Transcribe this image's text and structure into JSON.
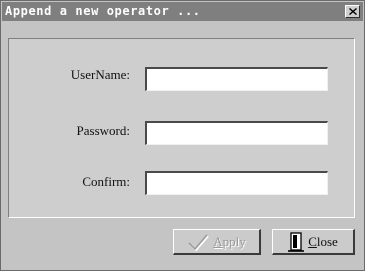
{
  "window": {
    "title": "Append a new operator ..."
  },
  "form": {
    "username_label": "UserName:",
    "username_value": "",
    "password_label": "Password:",
    "password_value": "",
    "confirm_label": "Confirm:",
    "confirm_value": ""
  },
  "buttons": {
    "apply_label": "Apply",
    "apply_icon": "checkmark-icon",
    "close_label": "Close",
    "close_icon": "door-exit-icon"
  }
}
